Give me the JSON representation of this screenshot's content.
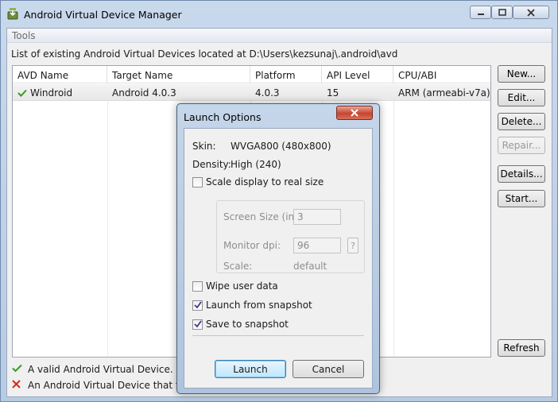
{
  "window": {
    "title": "Android Virtual Device Manager"
  },
  "menu": {
    "tools": "Tools"
  },
  "location_label": "List of existing Android Virtual Devices located at D:\\Users\\kezsunaj\\.android\\avd",
  "table": {
    "headers": [
      "AVD Name",
      "Target Name",
      "Platform",
      "API Level",
      "CPU/ABI"
    ],
    "rows": [
      {
        "name": "Windroid",
        "target": "Android 4.0.3",
        "platform": "4.0.3",
        "api": "15",
        "cpu": "ARM (armeabi-v7a)"
      }
    ]
  },
  "buttons": {
    "new": "New...",
    "edit": "Edit...",
    "delete": "Delete...",
    "repair": "Repair...",
    "details": "Details...",
    "start": "Start...",
    "refresh": "Refresh"
  },
  "legend": {
    "valid": "A valid Android Virtual Device.",
    "failed": "An Android Virtual Device that failed"
  },
  "dialog": {
    "title": "Launch Options",
    "skin_label": "Skin:",
    "skin_value": "WVGA800 (480x800)",
    "density_label": "Density:",
    "density_value": "High (240)",
    "scale_display": "Scale display to real size",
    "screen_size_label": "Screen Size (in):",
    "screen_size_value": "3",
    "monitor_dpi_label": "Monitor dpi:",
    "monitor_dpi_value": "96",
    "help": "?",
    "scale_label": "Scale:",
    "scale_value": "default",
    "wipe_user_data": "Wipe user data",
    "launch_from_snapshot": "Launch from snapshot",
    "save_to_snapshot": "Save to snapshot",
    "launch": "Launch",
    "cancel": "Cancel"
  },
  "colors": {
    "check_green": "#3a9a1f",
    "error_red": "#d42a1e",
    "title_bar": "#c9d9ec"
  }
}
